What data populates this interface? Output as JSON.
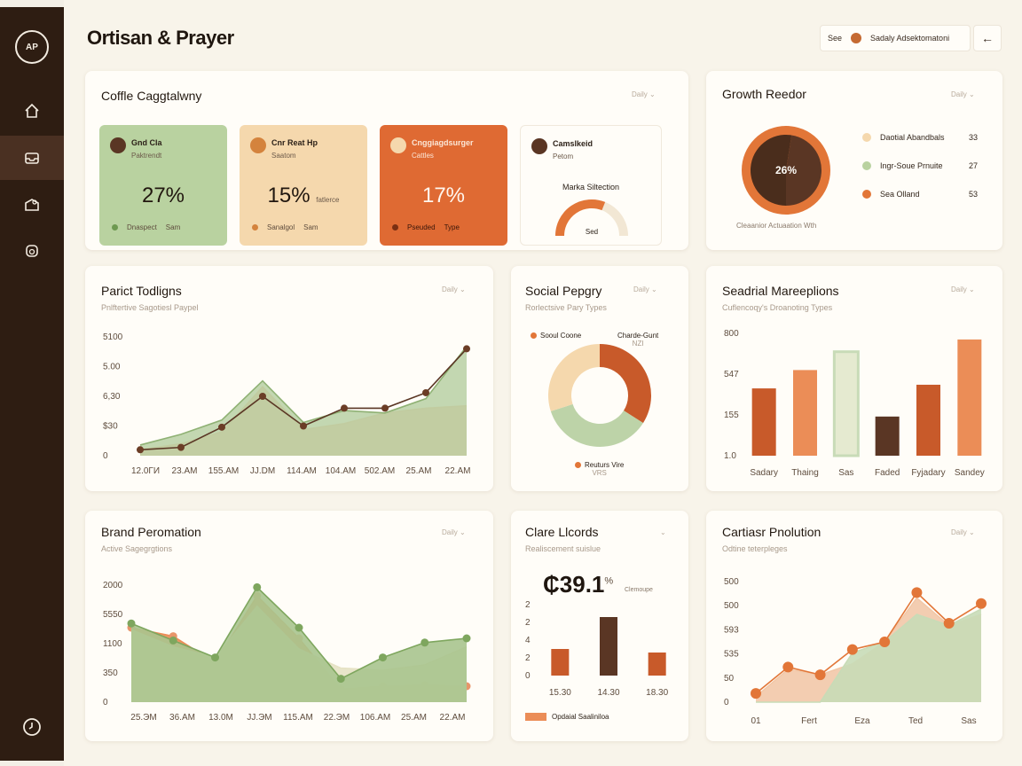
{
  "app": {
    "title": "Ortisan & Prayer",
    "logo_text": "AP"
  },
  "sidebar": {
    "items": [
      {
        "icon": "home-icon"
      },
      {
        "icon": "inbox-icon"
      },
      {
        "icon": "folder-icon"
      },
      {
        "icon": "badge-icon"
      }
    ],
    "bottom_icon": "clock-icon"
  },
  "topbar": {
    "see_label": "See",
    "account_label": "Sadaly Adsektomatoni",
    "back_label": "←"
  },
  "coffee": {
    "title": "Coffle Caggtalwny",
    "ctrl": "Daily ⌄",
    "tiles": [
      {
        "name": "Gnd Cla",
        "sub": "Paktrendt",
        "value": "27%",
        "foot_a": "Dnaspect",
        "foot_b": "Sam",
        "bg": "#b9d2a0",
        "dot": "#6d9950"
      },
      {
        "name": "Cnr Reat Hp",
        "sub": "Saatom",
        "value": "15%",
        "value_suffix": "fatlerce",
        "foot_a": "Sanalgol",
        "foot_b": "Sam",
        "bg": "#f5d8ad",
        "dot": "#d4833d"
      },
      {
        "name": "Cnggiagdsurger",
        "sub": "Cattles",
        "value": "17%",
        "foot_a": "Pseuded",
        "foot_b": "Type",
        "bg": "#df6a33",
        "dot": "#7a2f12"
      },
      {
        "name": "Camslkeid",
        "sub": "Petom",
        "gauge_label": "Marka Siltection",
        "gauge_center": "Sed",
        "gauge_value": 0.62
      }
    ]
  },
  "growth": {
    "title": "Growth Reedor",
    "ctrl": "Daily ⌄",
    "center_label": "26%",
    "caption": "Cleaanior Actuaation Wth",
    "slices": [
      {
        "label": "Daotial Abandbals",
        "value": "33",
        "color": "#f5d8ad",
        "share": 0.3
      },
      {
        "label": "Ingr-Soue Prnuite",
        "value": "27",
        "color": "#b9d2a0",
        "share": 0.26
      },
      {
        "label": "Sea Olland",
        "value": "53",
        "color": "#e27638",
        "share": 0.44
      }
    ]
  },
  "paract": {
    "title": "Parict Todligns",
    "sub": "Pnlftertive Sagotiesl Paypel",
    "ctrl": "Daily ⌄",
    "chart_data": {
      "type": "area",
      "categories": [
        "12.0ГИ",
        "23.AM",
        "155.AM",
        "JJ.DM",
        "114.AM",
        "104.AM",
        "502.AM",
        "25.AM",
        "22.AM"
      ],
      "ytick_labels": [
        "0",
        "$30",
        "6,30",
        "5.00",
        "5100"
      ],
      "series": [
        {
          "values": [
            5,
            10,
            20,
            58,
            22,
            27,
            36,
            40,
            42
          ],
          "color": "#eb8d57"
        },
        {
          "values": [
            9,
            18,
            30,
            63,
            28,
            38,
            36,
            48,
            92
          ],
          "color": "#bdd3a8"
        },
        {
          "values": [
            5,
            7,
            24,
            50,
            25,
            40,
            40,
            53,
            90
          ],
          "color": "#5a3624"
        }
      ],
      "ylim": [
        0,
        100
      ]
    }
  },
  "social": {
    "title": "Social Pepgry",
    "sub": "Rorlectsive Pary Types",
    "ctrl": "Daily ⌄",
    "legend_top_left": "Sooul Coone",
    "legend_top_right": "Charde-Gunt",
    "legend_top_right_sub": "NZI",
    "legend_bottom": "Reuturs Vire",
    "legend_bottom_sub": "VRS",
    "chart_data": {
      "type": "pie",
      "slices": [
        {
          "value": 34,
          "color": "#c85a2a"
        },
        {
          "value": 36,
          "color": "#bdd3a8"
        },
        {
          "value": 30,
          "color": "#f5d8ad"
        }
      ]
    }
  },
  "seasonal": {
    "title": "Seadrial Mareeplions",
    "sub": "Cuflencoqy's Droanoting Types",
    "ctrl": "Daily ⌄",
    "chart_data": {
      "type": "bar",
      "categories": [
        "Sadary",
        "Thaing",
        "Sas",
        "Faded",
        "Fyjadary",
        "Sandey"
      ],
      "ytick_labels": [
        "1.0",
        "155",
        "547",
        "800"
      ],
      "values": [
        55,
        70,
        85,
        32,
        58,
        95
      ],
      "colors": [
        "#c85a2a",
        "#eb8d57",
        "#e5ead0",
        "#5a3624",
        "#c85a2a",
        "#eb8d57"
      ],
      "ylim": [
        0,
        100
      ]
    }
  },
  "brand": {
    "title": "Brand Peromation",
    "sub": "Active Sagegrgtions",
    "ctrl": "Daily ⌄",
    "chart_data": {
      "type": "area",
      "categories": [
        "25.ЭM",
        "36.AM",
        "13.0M",
        "JJ.ЭM",
        "115.AM",
        "22.ЭM",
        "106.AM",
        "25.AM",
        "22.AM"
      ],
      "ytick_labels": [
        "0",
        "350",
        "1100",
        "5550",
        "2000"
      ],
      "series": [
        {
          "values": [
            70,
            62,
            37,
            100,
            60,
            12,
            15,
            16,
            15
          ],
          "color": "#eb8d57"
        },
        {
          "values": [
            68,
            52,
            42,
            90,
            50,
            32,
            30,
            35,
            52
          ],
          "color": "#e6e2c4"
        },
        {
          "values": [
            74,
            58,
            42,
            108,
            70,
            22,
            42,
            56,
            60
          ],
          "color": "#a9c48e"
        }
      ],
      "ylim": [
        0,
        110
      ]
    }
  },
  "clare": {
    "title": "Clare Llcords",
    "sub": "Realiscement suislue",
    "ctrl": "⌄",
    "value": "₵39.1",
    "value_sup": "%",
    "value_note": "Clemoupe",
    "legend": "Opdaial Saaliniloa",
    "chart_data": {
      "type": "bar",
      "categories": [
        "15.30",
        "14.30",
        "18.30"
      ],
      "ytick_labels": [
        "0",
        "2",
        "4",
        "2",
        "2"
      ],
      "values": [
        1.5,
        3.3,
        1.3
      ],
      "colors": [
        "#c85a2a",
        "#5a3624",
        "#c85a2a"
      ],
      "ylim": [
        0,
        4
      ]
    }
  },
  "cartesian": {
    "title": "Cartiasr Pnolution",
    "sub": "Odtine teterpleges",
    "ctrl": "Daily ⌄",
    "chart_data": {
      "type": "area",
      "categories": [
        "01",
        "Fert",
        "Eza",
        "Ted",
        "Sas"
      ],
      "ytick_labels": [
        "0",
        "50",
        "535",
        "593",
        "500",
        "500"
      ],
      "series": [
        {
          "values": [
            5,
            30,
            25,
            35,
            55,
            95,
            70,
            80
          ],
          "color": "#f2c8a8"
        },
        {
          "values": [
            0,
            0,
            0,
            45,
            55,
            80,
            70,
            85
          ],
          "color": "#c8dbb7"
        },
        {
          "values": [
            8,
            32,
            25,
            48,
            55,
            100,
            72,
            90
          ],
          "color": "#e27638"
        }
      ],
      "ylim": [
        0,
        110
      ]
    }
  }
}
